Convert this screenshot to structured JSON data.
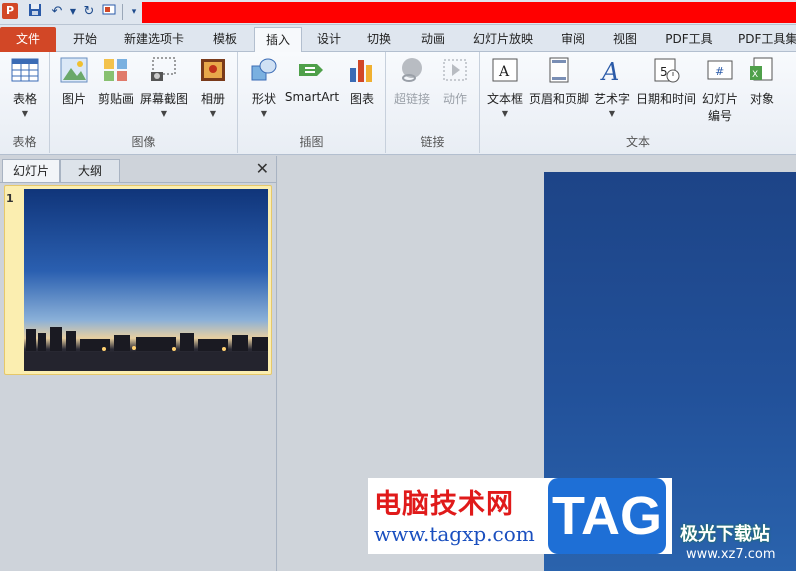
{
  "app": {
    "logo_letter": "P"
  },
  "qat": {
    "save_icon": "save-icon",
    "undo_icon": "undo-icon",
    "redo_icon": "redo-icon",
    "customize_icon": "customize-icon"
  },
  "tabs": [
    {
      "label": "文件"
    },
    {
      "label": "开始"
    },
    {
      "label": "新建选项卡"
    },
    {
      "label": "模板"
    },
    {
      "label": "插入"
    },
    {
      "label": "设计"
    },
    {
      "label": "切换"
    },
    {
      "label": "动画"
    },
    {
      "label": "幻灯片放映"
    },
    {
      "label": "审阅"
    },
    {
      "label": "视图"
    },
    {
      "label": "PDF工具"
    },
    {
      "label": "PDF工具集"
    }
  ],
  "ribbon": {
    "groups": {
      "table": "表格",
      "images": "图像",
      "illustrations": "插图",
      "links": "链接",
      "text": "文本"
    },
    "buttons": {
      "table": "表格",
      "picture": "图片",
      "clipart": "剪贴画",
      "screenshot": "屏幕截图",
      "album": "相册",
      "shapes": "形状",
      "smartart": "SmartArt",
      "chart": "图表",
      "hyperlink": "超链接",
      "action": "动作",
      "textbox": "文本框",
      "header_footer": "页眉和页脚",
      "wordart": "艺术字",
      "datetime": "日期和时间",
      "slide_number_1": "幻灯片",
      "slide_number_2": "编号",
      "object": "对象"
    }
  },
  "panel": {
    "tab_slides": "幻灯片",
    "tab_outline": "大纲",
    "close": "✕",
    "slide_number": "1"
  },
  "watermark": {
    "line1": "电脑技术网",
    "line2": "www.tagxp.com",
    "logo": "TAG",
    "side1": "极光下载站",
    "side2": "www.xz7.com"
  },
  "colors": {
    "accent": "#d24726",
    "title_bar": "#ff0000",
    "slide_bg": "#22519a"
  }
}
